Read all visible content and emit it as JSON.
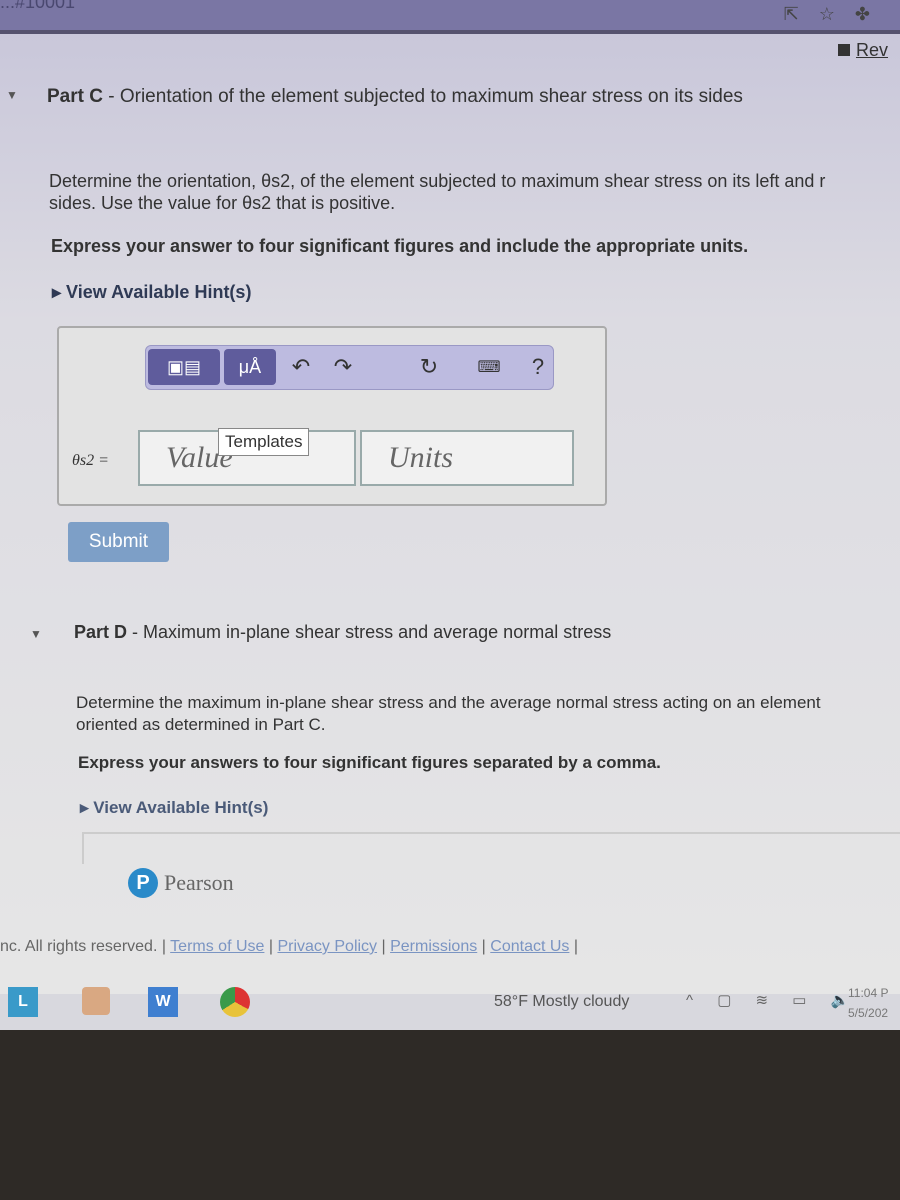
{
  "browser": {
    "url_fragment": "...#10001"
  },
  "review_link": "Rev",
  "partC": {
    "label": "Part C",
    "title": " - Orientation of the element subjected to maximum shear stress on its sides",
    "question_line1": "Determine the orientation, θs2, of the element subjected to maximum shear stress on its left and r",
    "question_line2": "sides. Use the value for θs2 that is positive.",
    "instruction": "Express your answer to four significant figures and include the appropriate units.",
    "hint": "View Available Hint(s)",
    "toolbar": {
      "templates_label": "Templates",
      "units_symbol": "μÅ",
      "help": "?"
    },
    "answer_label": "θs2 =",
    "value_placeholder": "Value",
    "units_placeholder": "Units",
    "submit": "Submit"
  },
  "partD": {
    "label": "Part D",
    "title": " - Maximum in-plane shear stress and average normal stress",
    "question_line1": "Determine the maximum in-plane shear stress and the average normal stress acting on an element",
    "question_line2": "oriented as determined in Part C.",
    "instruction": "Express your answers to four significant figures separated by a comma.",
    "hint": "View Available Hint(s)"
  },
  "brand": "Pearson",
  "footer": {
    "copyright": "nc. All rights reserved.",
    "links": [
      "Terms of Use",
      "Privacy Policy",
      "Permissions",
      "Contact Us"
    ]
  },
  "taskbar": {
    "weather": "58°F  Mostly cloudy",
    "time": "11:04 P",
    "date": "5/5/202"
  }
}
